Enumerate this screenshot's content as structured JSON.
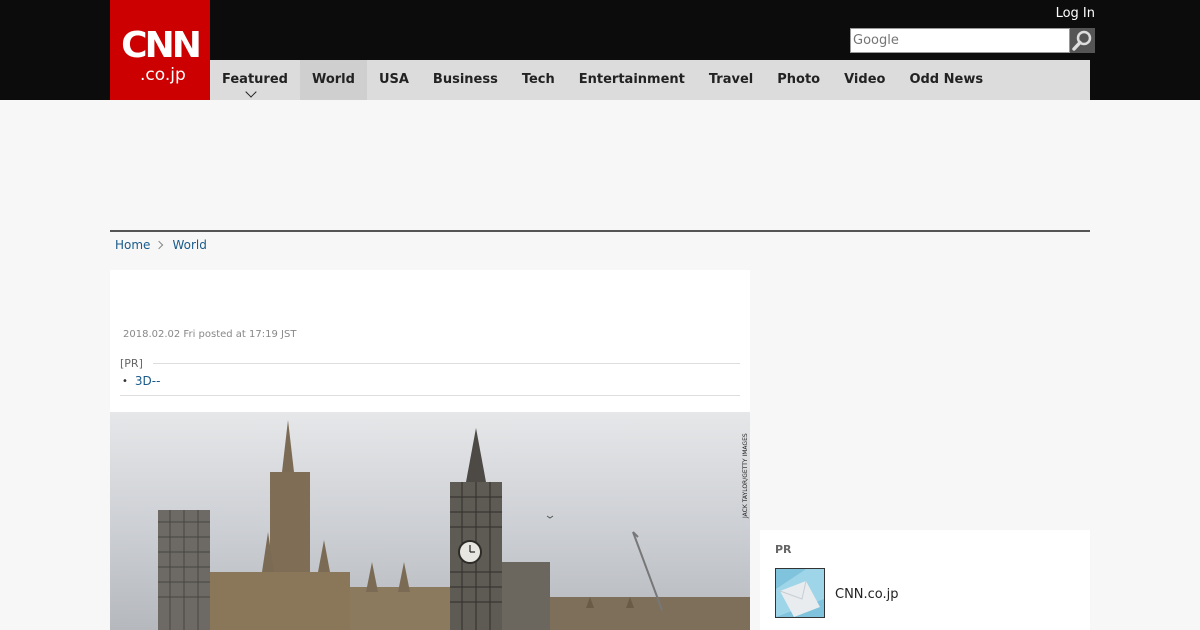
{
  "header": {
    "logo_main": "CNN",
    "logo_sub": ".co.jp",
    "login_label": "Log In",
    "search_placeholder": "Google"
  },
  "nav": {
    "items": [
      {
        "label": "Featured"
      },
      {
        "label": "World"
      },
      {
        "label": "USA"
      },
      {
        "label": "Business"
      },
      {
        "label": "Tech"
      },
      {
        "label": "Entertainment"
      },
      {
        "label": "Travel"
      },
      {
        "label": "Photo"
      },
      {
        "label": "Video"
      },
      {
        "label": "Odd News"
      }
    ],
    "active": "World"
  },
  "breadcrumb": {
    "home": "Home",
    "current": "World"
  },
  "article": {
    "posted": "2018.02.02 Fri posted at 17:19 JST",
    "pr_label": "[PR]",
    "pr_link": "3D--",
    "photo_credit": "JACK TAYLOR/GETTY IMAGES"
  },
  "sidebar": {
    "pr_title": "PR",
    "pr_item_label": "CNN.co.jp"
  },
  "colors": {
    "brand_red": "#cc0000",
    "header_bg": "#0c0c0c",
    "nav_bg": "#dcdcdc",
    "link": "#1a5a8a"
  }
}
